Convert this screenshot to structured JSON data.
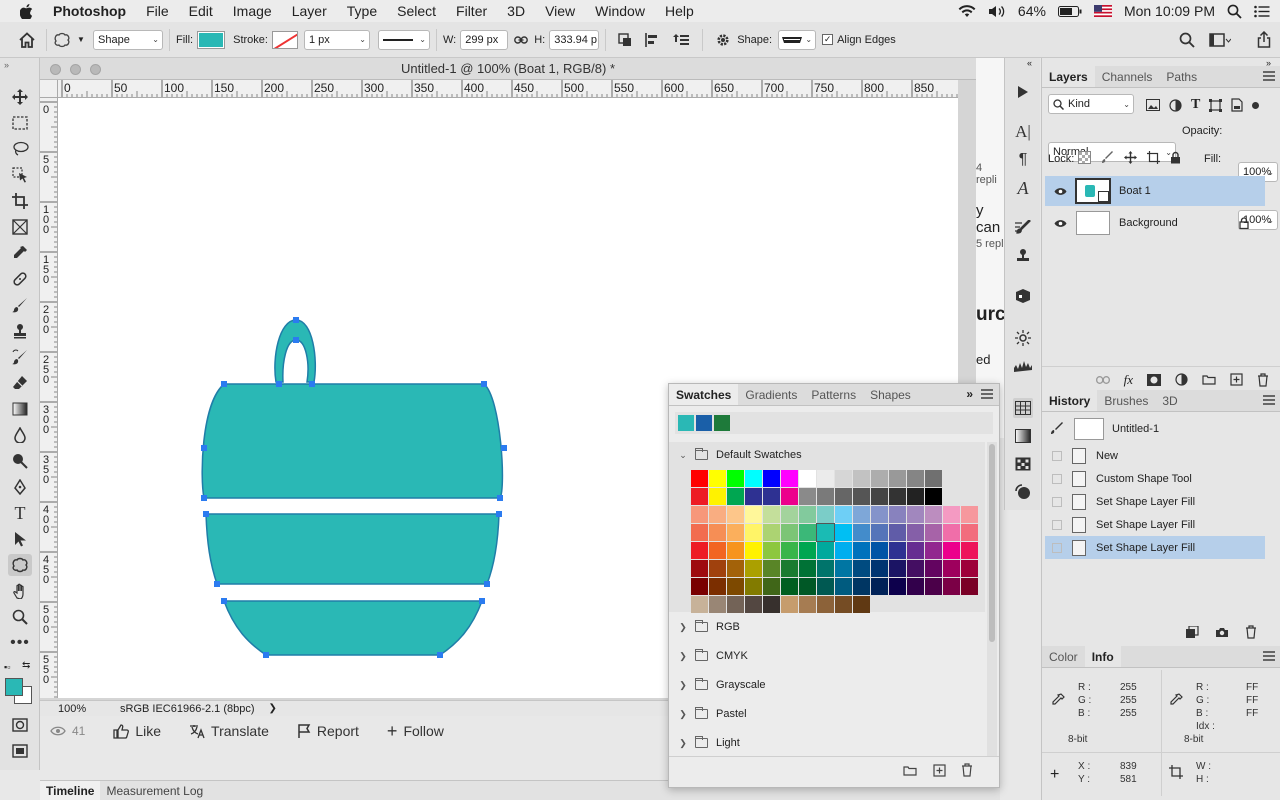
{
  "menubar": {
    "apple": "",
    "app": "Photoshop",
    "items": [
      "File",
      "Edit",
      "Image",
      "Layer",
      "Type",
      "Select",
      "Filter",
      "3D",
      "View",
      "Window",
      "Help"
    ],
    "battery": "64%",
    "clock": "Mon 10:09 PM"
  },
  "options": {
    "mode": "Shape",
    "fill_label": "Fill:",
    "fill_color": "#2ab8b5",
    "stroke_label": "Stroke:",
    "stroke_width": "1 px",
    "w_label": "W:",
    "w_value": "299 px",
    "h_label": "H:",
    "h_value": "333.94 p",
    "shape_label": "Shape:",
    "align_edges": "Align Edges",
    "align_checked": true
  },
  "document": {
    "title": "Untitled-1 @ 100% (Boat 1, RGB/8) *",
    "zoom": "100%",
    "profile": "sRGB IEC61966-2.1 (8bpc)",
    "ruler_top": [
      "0",
      "50",
      "100",
      "150",
      "200",
      "250",
      "300",
      "350",
      "400",
      "450",
      "500",
      "550",
      "600",
      "650",
      "700",
      "750",
      "800",
      "850"
    ],
    "ruler_left": [
      "0",
      "5\n0",
      "1\n0\n0",
      "1\n5\n0",
      "2\n0\n0",
      "2\n5\n0",
      "3\n0\n0",
      "3\n5\n0",
      "4\n0\n0",
      "4\n5\n0",
      "5\n0\n0",
      "5\n5\n0",
      "6\n0\n0"
    ],
    "shape_color": "#2ab8b5",
    "shape_stroke": "#1f7da8",
    "handle_color": "#2b7bf0"
  },
  "behind": {
    "views": "41",
    "like": "Like",
    "translate": "Translate",
    "report": "Report",
    "follow": "Follow",
    "frag1": "4 repli",
    "frag2": "y can",
    "frag3": "5 repl",
    "frag4": "urce",
    "frag5": "ed"
  },
  "bottom_tabs": [
    "Timeline",
    "Measurement Log"
  ],
  "swatches_panel": {
    "tabs": [
      "Swatches",
      "Gradients",
      "Patterns",
      "Shapes"
    ],
    "recent": [
      "#2ab8b5",
      "#1a5fa8",
      "#1e7a3a"
    ],
    "default_group": "Default Swatches",
    "groups": [
      "RGB",
      "CMYK",
      "Grayscale",
      "Pastel",
      "Light"
    ],
    "grid": [
      [
        "#ff0000",
        "#ffff00",
        "#00ff00",
        "#00ffff",
        "#0000ff",
        "#ff00ff",
        "#ffffff",
        "#ebebeb",
        "#d6d6d6",
        "#c2c2c2",
        "#adadad",
        "#999999",
        "#858585",
        "#707070"
      ],
      [
        "#ed1c24",
        "#fff200",
        "#00a651",
        "#2e3192",
        "#2e3192",
        "#ec008c",
        "#8a8a8a",
        "#7a7a7a",
        "#666666",
        "#555555",
        "#444444",
        "#333333",
        "#222222",
        "#000000"
      ],
      [
        "#f7977a",
        "#f9ad81",
        "#fdc68a",
        "#fff79a",
        "#c4df9b",
        "#a3d39c",
        "#82ca9d",
        "#7bcdc8",
        "#6ecff6",
        "#7ea7d8",
        "#8493ca",
        "#8882be",
        "#a187be",
        "#bc8dbf",
        "#f49ac2",
        "#f6989d"
      ],
      [
        "#f26c4f",
        "#f68e55",
        "#fbaf5c",
        "#fff467",
        "#acd372",
        "#7cc576",
        "#3bb878",
        "#1abbb4",
        "#00bff3",
        "#438ccb",
        "#5574b9",
        "#605ca8",
        "#855fa8",
        "#a763a8",
        "#f06ea9",
        "#f26d7d"
      ],
      [
        "#ed1c24",
        "#f26522",
        "#f7941d",
        "#fff200",
        "#8dc73f",
        "#39b54a",
        "#00a651",
        "#00a99d",
        "#00aeef",
        "#0072bc",
        "#0054a6",
        "#2e3192",
        "#662d91",
        "#92278f",
        "#ec008c",
        "#ed145b"
      ],
      [
        "#9e0b0f",
        "#a0410d",
        "#a36209",
        "#aba000",
        "#598527",
        "#1a7b30",
        "#007236",
        "#00746b",
        "#0076a3",
        "#004b80",
        "#003471",
        "#1b1464",
        "#440e62",
        "#630460",
        "#9e005d",
        "#9e0039"
      ],
      [
        "#790000",
        "#7b2e00",
        "#7d4900",
        "#827b00",
        "#406618",
        "#005e20",
        "#005826",
        "#005952",
        "#005b7f",
        "#003663",
        "#002157",
        "#0d004c",
        "#32004b",
        "#4b0049",
        "#7b0046",
        "#7a0026"
      ],
      [
        "#c7b299",
        "#998675",
        "#736357",
        "#534741",
        "#37302d",
        "#c69c6d",
        "#a67c52",
        "#8c6239",
        "#754c24",
        "#603913"
      ]
    ]
  },
  "layers_panel": {
    "tabs": [
      "Layers",
      "Channels",
      "Paths"
    ],
    "filter": "Kind",
    "blend": "Normal",
    "opacity_label": "Opacity:",
    "opacity": "100%",
    "lock_label": "Lock:",
    "fill_label": "Fill:",
    "fill": "100%",
    "layers": [
      {
        "name": "Boat 1",
        "selected": true
      },
      {
        "name": "Background",
        "selected": false,
        "locked": true
      }
    ]
  },
  "history_panel": {
    "tabs": [
      "History",
      "Brushes",
      "3D"
    ],
    "snapshot": "Untitled-1",
    "states": [
      "New",
      "Custom Shape Tool",
      "Set Shape Layer Fill",
      "Set Shape Layer Fill",
      "Set Shape Layer Fill"
    ],
    "selected_index": 4
  },
  "info_panel": {
    "tabs": [
      "Color",
      "Info"
    ],
    "r_label": "R :",
    "g_label": "G :",
    "b_label": "B :",
    "r": "255",
    "g": "255",
    "b": "255",
    "r_hex": "FF",
    "g_hex": "FF",
    "b_hex": "FF",
    "idx_label": "Idx :",
    "bit_left": "8-bit",
    "bit_right": "8-bit",
    "x_label": "X :",
    "y_label": "Y :",
    "x": "839",
    "y": "581",
    "w_label": "W :",
    "h_label": "H :"
  },
  "colors": {
    "foreground": "#2ab8b5",
    "background": "#ffffff",
    "selection": "#b6cfea"
  }
}
